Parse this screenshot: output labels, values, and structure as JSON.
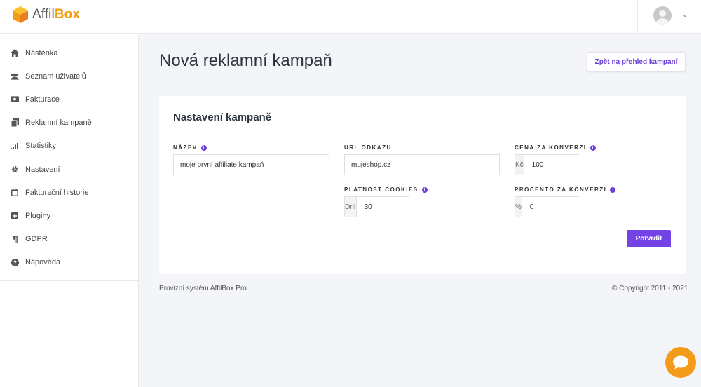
{
  "brand": {
    "name_part1": "Affil",
    "name_part2": "Box",
    "accent": "#f39c12",
    "logo_icon": "cube-logo-icon"
  },
  "user_menu": {
    "avatar_icon": "user-avatar-icon",
    "chevron": "⌄"
  },
  "sidebar": {
    "items": [
      {
        "label": "Nástěnka",
        "icon": "home-icon"
      },
      {
        "label": "Seznam uživatelů",
        "icon": "users-icon"
      },
      {
        "label": "Fakturace",
        "icon": "money-icon"
      },
      {
        "label": "Reklamní kampaně",
        "icon": "copy-icon"
      },
      {
        "label": "Statistiky",
        "icon": "signal-icon"
      },
      {
        "label": "Nastavení",
        "icon": "gear-icon"
      },
      {
        "label": "Fakturační historie",
        "icon": "calendar-icon"
      },
      {
        "label": "Pluginy",
        "icon": "plus-square-icon"
      },
      {
        "label": "GDPR",
        "icon": "pilcrow-icon"
      },
      {
        "label": "Nápověda",
        "icon": "question-circle-icon"
      }
    ]
  },
  "page": {
    "title": "Nová reklamní kampaň",
    "back_button": "Zpět na přehled kampaní"
  },
  "form": {
    "title": "Nastavení kampaně",
    "name": {
      "label": "NÁZEV",
      "value": "moje první affiliate kampaň"
    },
    "url": {
      "label": "URL ODKAZU",
      "value": "mujeshop.cz"
    },
    "price": {
      "label": "CENA ZA KONVERZI",
      "addon": "Kč",
      "value": "100"
    },
    "cookies": {
      "label": "PLATNOST COOKIES",
      "addon": "Dní",
      "value": "30"
    },
    "percent": {
      "label": "PROCENTO ZA KONVERZI",
      "addon": "%",
      "value": "0"
    },
    "submit": "Potvrdit",
    "accent": "#7443e6"
  },
  "footer": {
    "left": "Provizní systém AffilBox Pro",
    "right": "© Copyright 2011 - 2021"
  },
  "chat": {
    "icon": "chat-bubble-icon",
    "color": "#f59b1a"
  }
}
